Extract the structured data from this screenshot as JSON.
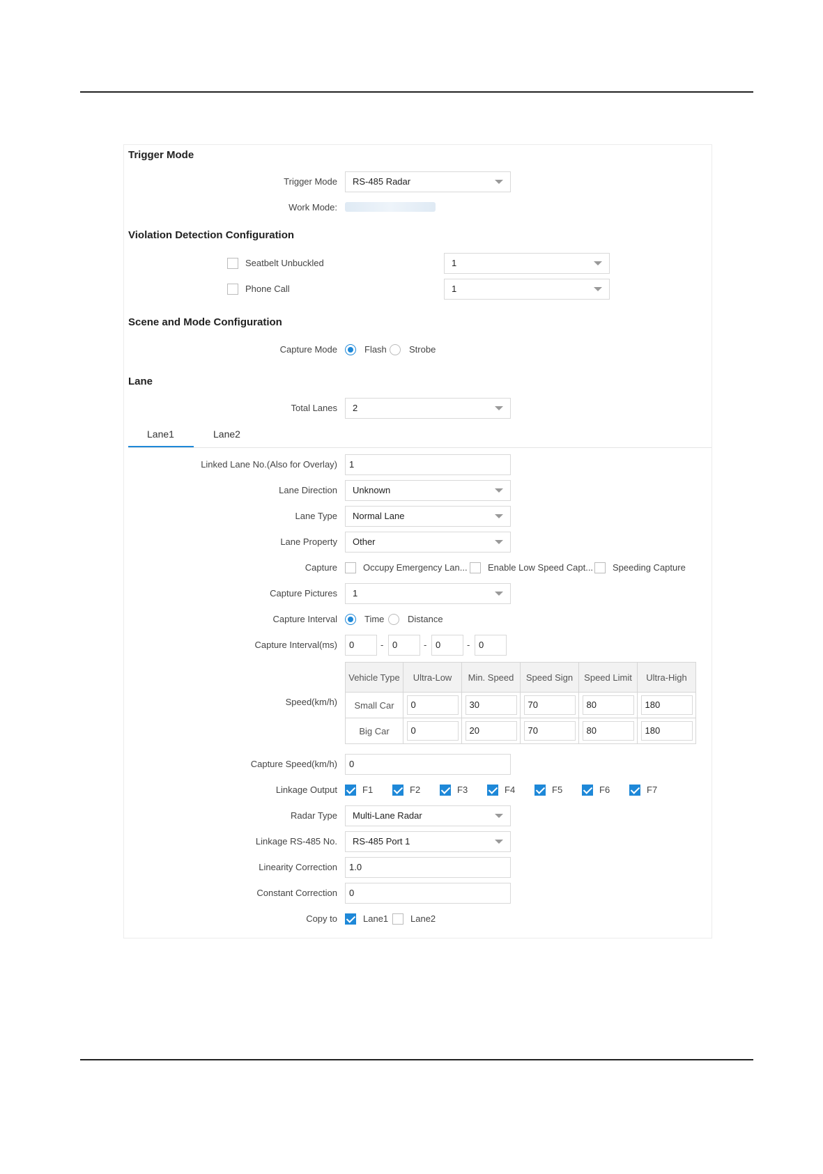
{
  "trigger": {
    "section_title": "Trigger Mode",
    "trigger_mode_label": "Trigger Mode",
    "trigger_mode_value": "RS-485 Radar",
    "work_mode_label": "Work Mode:"
  },
  "violation": {
    "section_title": "Violation Detection Configuration",
    "seatbelt_label": "Seatbelt Unbuckled",
    "seatbelt_value": "1",
    "phone_label": "Phone Call",
    "phone_value": "1"
  },
  "scene": {
    "section_title": "Scene and Mode Configuration",
    "capture_mode_label": "Capture Mode",
    "flash": "Flash",
    "strobe": "Strobe"
  },
  "lane": {
    "section_title": "Lane",
    "total_lanes_label": "Total Lanes",
    "total_lanes_value": "2",
    "tabs": [
      "Lane1",
      "Lane2"
    ],
    "linked_lane_label": "Linked Lane No.(Also for Overlay)",
    "linked_lane_value": "1",
    "direction_label": "Lane Direction",
    "direction_value": "Unknown",
    "type_label": "Lane Type",
    "type_value": "Normal Lane",
    "property_label": "Lane Property",
    "property_value": "Other",
    "capture_label": "Capture",
    "capture_opts": [
      "Occupy Emergency Lan...",
      "Enable Low Speed Capt...",
      "Speeding Capture"
    ],
    "pictures_label": "Capture Pictures",
    "pictures_value": "1",
    "interval_label": "Capture Interval",
    "interval_time": "Time",
    "interval_distance": "Distance",
    "interval_ms_label": "Capture Interval(ms)",
    "interval_ms_values": [
      "0",
      "0",
      "0",
      "0"
    ],
    "interval_sep": "-",
    "speed_label": "Speed(km/h)",
    "speed_headers": [
      "Vehicle Type",
      "Ultra-Low",
      "Min. Speed",
      "Speed Sign",
      "Speed Limit",
      "Ultra-High"
    ],
    "speed_rows": [
      {
        "type": "Small Car",
        "values": [
          "0",
          "30",
          "70",
          "80",
          "180"
        ]
      },
      {
        "type": "Big Car",
        "values": [
          "0",
          "20",
          "70",
          "80",
          "180"
        ]
      }
    ],
    "capture_speed_label": "Capture Speed(km/h)",
    "capture_speed_value": "0",
    "linkage_label": "Linkage Output",
    "linkage_opts": [
      "F1",
      "F2",
      "F3",
      "F4",
      "F5",
      "F6",
      "F7"
    ],
    "radar_type_label": "Radar Type",
    "radar_type_value": "Multi-Lane Radar",
    "rs485_label": "Linkage RS-485 No.",
    "rs485_value": "RS-485 Port 1",
    "linearity_label": "Linearity Correction",
    "linearity_value": "1.0",
    "constant_label": "Constant Correction",
    "constant_value": "0",
    "copy_label": "Copy to",
    "copy_opts": [
      "Lane1",
      "Lane2"
    ]
  },
  "colors": {
    "accent": "#1e88d8",
    "border": "#d9d9d9"
  }
}
